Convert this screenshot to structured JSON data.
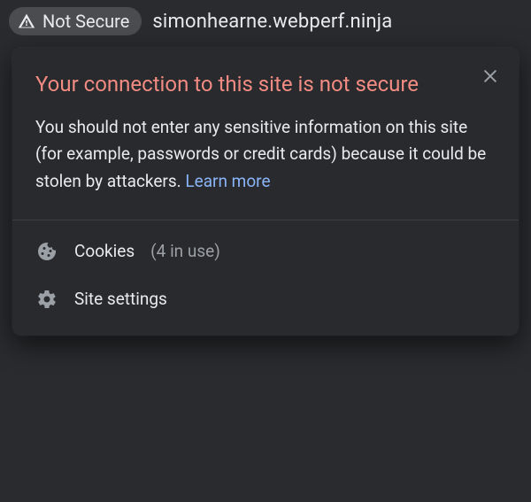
{
  "addressBar": {
    "securityLabel": "Not Secure",
    "url": "simonhearne.webperf.ninja"
  },
  "popover": {
    "title": "Your connection to this site is not secure",
    "body": "You should not enter any sensitive information on this site (for example, passwords or credit cards) because it could be stolen by attackers. ",
    "learnMore": "Learn more",
    "cookies": {
      "label": "Cookies",
      "count": "(4 in use)"
    },
    "siteSettings": "Site settings"
  }
}
